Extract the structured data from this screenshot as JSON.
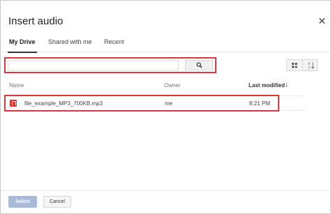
{
  "dialog": {
    "title": "Insert audio",
    "close_glyph": "✕"
  },
  "tabs": [
    {
      "label": "My Drive",
      "active": true
    },
    {
      "label": "Shared with me",
      "active": false
    },
    {
      "label": "Recent",
      "active": false
    }
  ],
  "search": {
    "value": "",
    "placeholder": "",
    "button_icon": "search-icon"
  },
  "view_toggle": {
    "icons": [
      "grid-view-icon",
      "sort-az-icon"
    ]
  },
  "table": {
    "columns": {
      "name": "Name",
      "owner": "Owner",
      "last_modified": "Last modified",
      "sort_glyph": "↓"
    },
    "rows": [
      {
        "icon": "audio-file-icon",
        "name": "file_example_MP3_700KB.mp3",
        "owner": "me",
        "last_modified": "8:21 PM"
      }
    ]
  },
  "footer": {
    "select_label": "Select",
    "cancel_label": "Cancel"
  },
  "colors": {
    "highlight": "#d9363e",
    "primary_disabled": "#a9b9d8",
    "file_icon": "#e3342f"
  }
}
